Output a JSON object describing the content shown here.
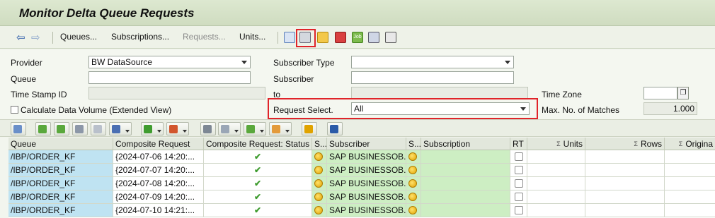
{
  "window": {
    "title": "Monitor Delta Queue Requests"
  },
  "toolbar": {
    "back_icon": "arrow-left-icon",
    "forward_icon": "arrow-right-icon",
    "menus": [
      "Queues...",
      "Subscriptions...",
      "Requests...",
      "Units..."
    ],
    "tool_icons": [
      "refresh-icon",
      "settings-wrench-icon",
      "hierarchy-icon",
      "alert-icon",
      "job-icon",
      "display-list-icon",
      "flag-icon"
    ]
  },
  "form": {
    "provider_label": "Provider",
    "provider_value": "BW DataSource",
    "queue_label": "Queue",
    "queue_value": "",
    "timestamp_label": "Time Stamp ID",
    "timestamp_value": "",
    "calc_volume_label": "Calculate Data Volume (Extended View)",
    "calc_volume_checked": false,
    "subscriber_type_label": "Subscriber Type",
    "subscriber_type_value": "",
    "subscriber_label": "Subscriber",
    "subscriber_value": "",
    "to_label": "to",
    "to_value": "",
    "request_select_label": "Request Select.",
    "request_select_value": "All",
    "time_zone_label": "Time Zone",
    "time_zone_value": "",
    "max_matches_label": "Max. No. of Matches",
    "max_matches_value": "1.000"
  },
  "grid": {
    "columns": {
      "queue": "Queue",
      "composite_request": "Composite Request",
      "composite_status": "Composite Request: Status",
      "s1": "S...",
      "subscriber": "Subscriber",
      "s2": "S...",
      "subscription": "Subscription",
      "rt": "RT",
      "units": "Units",
      "rows": "Rows",
      "origin": "Origina"
    },
    "rows": [
      {
        "queue": "/IBP/ORDER_KF",
        "composite_request": "{2024-07-06 14:20:...",
        "subscriber": "SAP BUSINESSOB..."
      },
      {
        "queue": "/IBP/ORDER_KF",
        "composite_request": "{2024-07-07 14:20:...",
        "subscriber": "SAP BUSINESSOB..."
      },
      {
        "queue": "/IBP/ORDER_KF",
        "composite_request": "{2024-07-08 14:20:...",
        "subscriber": "SAP BUSINESSOB..."
      },
      {
        "queue": "/IBP/ORDER_KF",
        "composite_request": "{2024-07-09 14:20:...",
        "subscriber": "SAP BUSINESSOB..."
      },
      {
        "queue": "/IBP/ORDER_KF",
        "composite_request": "{2024-07-10 14:21:...",
        "subscriber": "SAP BUSINESSOB..."
      }
    ]
  },
  "colors": {
    "highlight": "#e0242a",
    "key_column": "#bfe3f2",
    "green_column": "#cdeec3"
  }
}
